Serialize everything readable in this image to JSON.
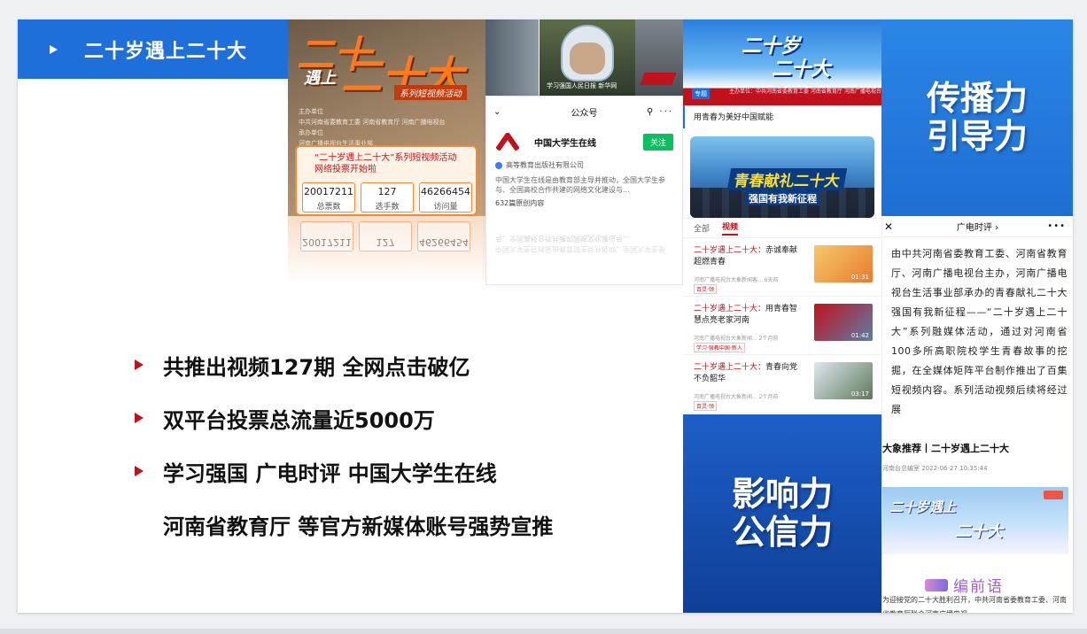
{
  "title": "二十岁遇上二十大",
  "bullets": [
    "共推出视频127期 全网点击破亿",
    "双平台投票总流量近5000万",
    "学习强国 广电时评 中国大学生在线",
    "河南省教育厅 等官方新媒体账号强势宣推"
  ],
  "tiles": {
    "top_line1": "传播力",
    "top_line2": "引导力",
    "bottom_line1": "影响力",
    "bottom_line2": "公信力"
  },
  "poster": {
    "big1": "二十",
    "big2": "遇上",
    "big3": "二十大",
    "slogan": "系列短视频活动",
    "credits": [
      "主办单位",
      "中共河南省委教育工委    河南省教育厅    河南广播电视台",
      "承办单位",
      "河南广播电视台生活事业部"
    ],
    "vote_title": "“二十岁遇上二十大”系列短视频活动网络投票开始啦",
    "stats": [
      {
        "value": "20017211",
        "label": "总票数"
      },
      {
        "value": "127",
        "label": "选手数"
      },
      {
        "value": "46266454",
        "label": "访问量"
      }
    ]
  },
  "photo_caption": "学习强国人民日报 新华网",
  "wechat": {
    "header": "公众号",
    "account_name": "中国大学生在线",
    "follow": "关注",
    "cert": "高等教育出版社有限公司",
    "desc": "中国大学生在线是由教育部主导并推动，全国大学生参与、全国高校合作共建的网络文化建设与...",
    "count": "632篇原创内容"
  },
  "sky_banner": {
    "t1": "二十岁",
    "t2": "二十大",
    "tag": "专题",
    "small": "主办单位：中共河南省委教育工委  河南省教育厅  河南广播电视台"
  },
  "subtitle_strip": "用青春为美好中国赋能",
  "grad_banner": {
    "line1": "青春献礼二十大",
    "line2": "强国有我新征程"
  },
  "video_list": {
    "tabs": [
      "全部",
      "视频"
    ],
    "items": [
      {
        "hl": "二十岁遇上二十大：",
        "title": "赤诚奉献 超燃青春",
        "meta": "河南广播电视台大象新闻客...    6天前",
        "chip": "百灵·领",
        "duration": "01:31"
      },
      {
        "hl": "二十岁遇上二十大：",
        "title": "用青春智慧点亮老家河南",
        "meta": "河南广播电视台大象新闻...    2个月前",
        "chip": "学习·强教中国·新人",
        "duration": "01:42"
      },
      {
        "hl": "二十岁遇上二十大：",
        "title": "青春向党 不负韶华",
        "meta": "河南广播电视台大象新闻...    2个月前",
        "chip": "百灵·领",
        "duration": "03:17"
      }
    ]
  },
  "article": {
    "header": "广电时评",
    "body": "由中共河南省委教育工委、河南省教育厅、河南广播电视台主办，河南广播电视台生活事业部承办的青春献礼二十大 强国有我新征程——“二十岁遇上二十大”系列融媒体活动，通过对河南省100多所高职院校学生青春故事的挖掘，在全媒体矩阵平台制作推出了百集短视频内容。系列活动视频后续将经过展",
    "recommend": "大象推荐丨二十岁遇上二十大",
    "meta": "河南台总编室    2022-06-27 10:35:44",
    "cloud1": "二十岁遇上",
    "cloud2": "二十大",
    "editor": "编前语",
    "footer": "为迎接党的二十大胜利召开，中共河南省委教育工委、河南省教育厅联合河南广播电视"
  },
  "colors": {
    "brand_blue": "#1e6fd9",
    "bullet_red": "#c0121d",
    "wechat_green": "#07c160"
  }
}
